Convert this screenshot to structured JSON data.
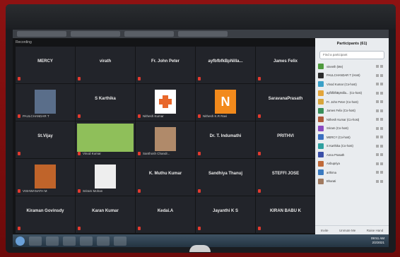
{
  "window": {
    "title": "Recording"
  },
  "grid": {
    "tiles": [
      {
        "name": "MERCY",
        "label": ""
      },
      {
        "name": "virath",
        "label": ""
      },
      {
        "name": "Fr. John Peter",
        "label": ""
      },
      {
        "name": "ayfbfbfkBpNilla...",
        "label": ""
      },
      {
        "name": "James Felix",
        "label": ""
      },
      {
        "name": "",
        "label": "PAULCHANDAR T"
      },
      {
        "name": "S Karthika",
        "label": ""
      },
      {
        "name": "",
        "label": "Nithesh Kumar"
      },
      {
        "name": "",
        "label": "Nithesh K.R Ravi"
      },
      {
        "name": "SaravanaPrasath",
        "label": ""
      },
      {
        "name": "St.Vijay",
        "label": ""
      },
      {
        "name": "",
        "label": "Vinod Kumar"
      },
      {
        "name": "",
        "label": "Santhosh Chandr..."
      },
      {
        "name": "Dr. T. Indumathi",
        "label": ""
      },
      {
        "name": "PRITHVI",
        "label": ""
      },
      {
        "name": "",
        "label": "VISHWANATH M"
      },
      {
        "name": "",
        "label": "Sriram Mohan"
      },
      {
        "name": "K. Muthu Kumar",
        "label": ""
      },
      {
        "name": "Sandhiya Thanuj",
        "label": ""
      },
      {
        "name": "STEFFI JOSE",
        "label": ""
      },
      {
        "name": "Kiraman Govinsdy",
        "label": ""
      },
      {
        "name": "Karan Kumar",
        "label": ""
      },
      {
        "name": "Kedai.A",
        "label": ""
      },
      {
        "name": "Jayanthi K S",
        "label": ""
      },
      {
        "name": "KIRAN BABU K",
        "label": ""
      }
    ]
  },
  "participants": {
    "header": "Participants (61)",
    "search_placeholder": "Find a participant",
    "list": [
      {
        "name": "vineeth (Me)",
        "color": "#4f9a3e"
      },
      {
        "name": "PAULCHANDAR T (Host)",
        "color": "#2b2b2b"
      },
      {
        "name": "Vinod Kumar (Co-host)",
        "color": "#3aa0c8"
      },
      {
        "name": "ayfbfbfkBpNilla... (Co-host)",
        "color": "#e3a53a"
      },
      {
        "name": "Fr. John Peter (Co-host)",
        "color": "#d8a63c"
      },
      {
        "name": "James Felix (Co-host)",
        "color": "#3a8f5a"
      },
      {
        "name": "Nithesh Kumar (Co-host)",
        "color": "#b05a3a"
      },
      {
        "name": "Sriram (Co-host)",
        "color": "#8a4ac0"
      },
      {
        "name": "MERCY (Co-host)",
        "color": "#3a6fc0"
      },
      {
        "name": "S Karthika (Co-host)",
        "color": "#2fa0a0"
      },
      {
        "name": "Anna Prasath",
        "color": "#3a4fa8"
      },
      {
        "name": "Anbupriya",
        "color": "#c06a3a"
      },
      {
        "name": "arthima",
        "color": "#3a7ac0"
      },
      {
        "name": "Bharati",
        "color": "#a07a60"
      }
    ],
    "footer": {
      "invite": "Invite",
      "unmute": "Unmute Me",
      "raise": "Raise Hand"
    }
  },
  "taskbar": {
    "time": "09:51 AM",
    "date": "2/2/2021"
  },
  "colors": {
    "frame": "#7a0b0b",
    "tile_bg": "#22242a",
    "mic_red": "#e03a2f",
    "panel_bg": "#e9ecef"
  }
}
